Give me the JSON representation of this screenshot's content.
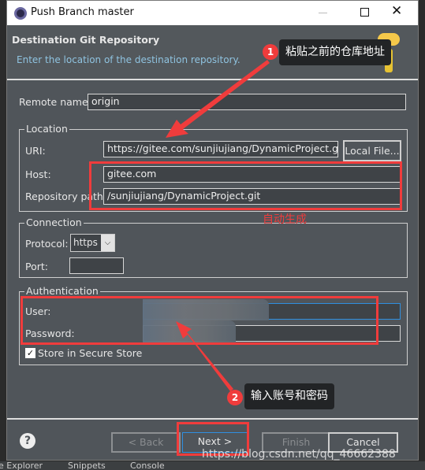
{
  "window": {
    "title": "Push Branch master"
  },
  "header": {
    "title": "Destination Git Repository",
    "subtitle": "Enter the location of the destination repository."
  },
  "remote": {
    "label": "Remote name:",
    "value": "origin"
  },
  "location": {
    "legend": "Location",
    "uri_label": "URI:",
    "uri_value": "https://gitee.com/sunjiujiang/DynamicProject.git",
    "local_file_label": "Local File...",
    "host_label": "Host:",
    "host_value": "gitee.com",
    "path_label": "Repository path:",
    "path_value": "/sunjiujiang/DynamicProject.git"
  },
  "connection": {
    "legend": "Connection",
    "protocol_label": "Protocol:",
    "protocol_value": "https",
    "port_label": "Port:",
    "port_value": ""
  },
  "authentication": {
    "legend": "Authentication",
    "user_label": "User:",
    "password_label": "Password:",
    "store_label": "Store in Secure Store",
    "store_checked": true
  },
  "buttons": {
    "back": "< Back",
    "next": "Next >",
    "finish": "Finish",
    "cancel": "Cancel"
  },
  "annotations": {
    "step1_num": "1",
    "step1_text": "粘贴之前的仓库地址",
    "auto_text": "自动生成",
    "step2_num": "2",
    "step2_text": "输入账号和密码",
    "watermark": "https://blog.csdn.net/qq_46662388"
  },
  "bottom_tabs": [
    "e Explorer",
    "Snippets",
    "Console"
  ],
  "colors": {
    "annotation_red": "#f03c3c",
    "dialog_bg": "#50555a",
    "subtitle": "#8fc3e0"
  }
}
